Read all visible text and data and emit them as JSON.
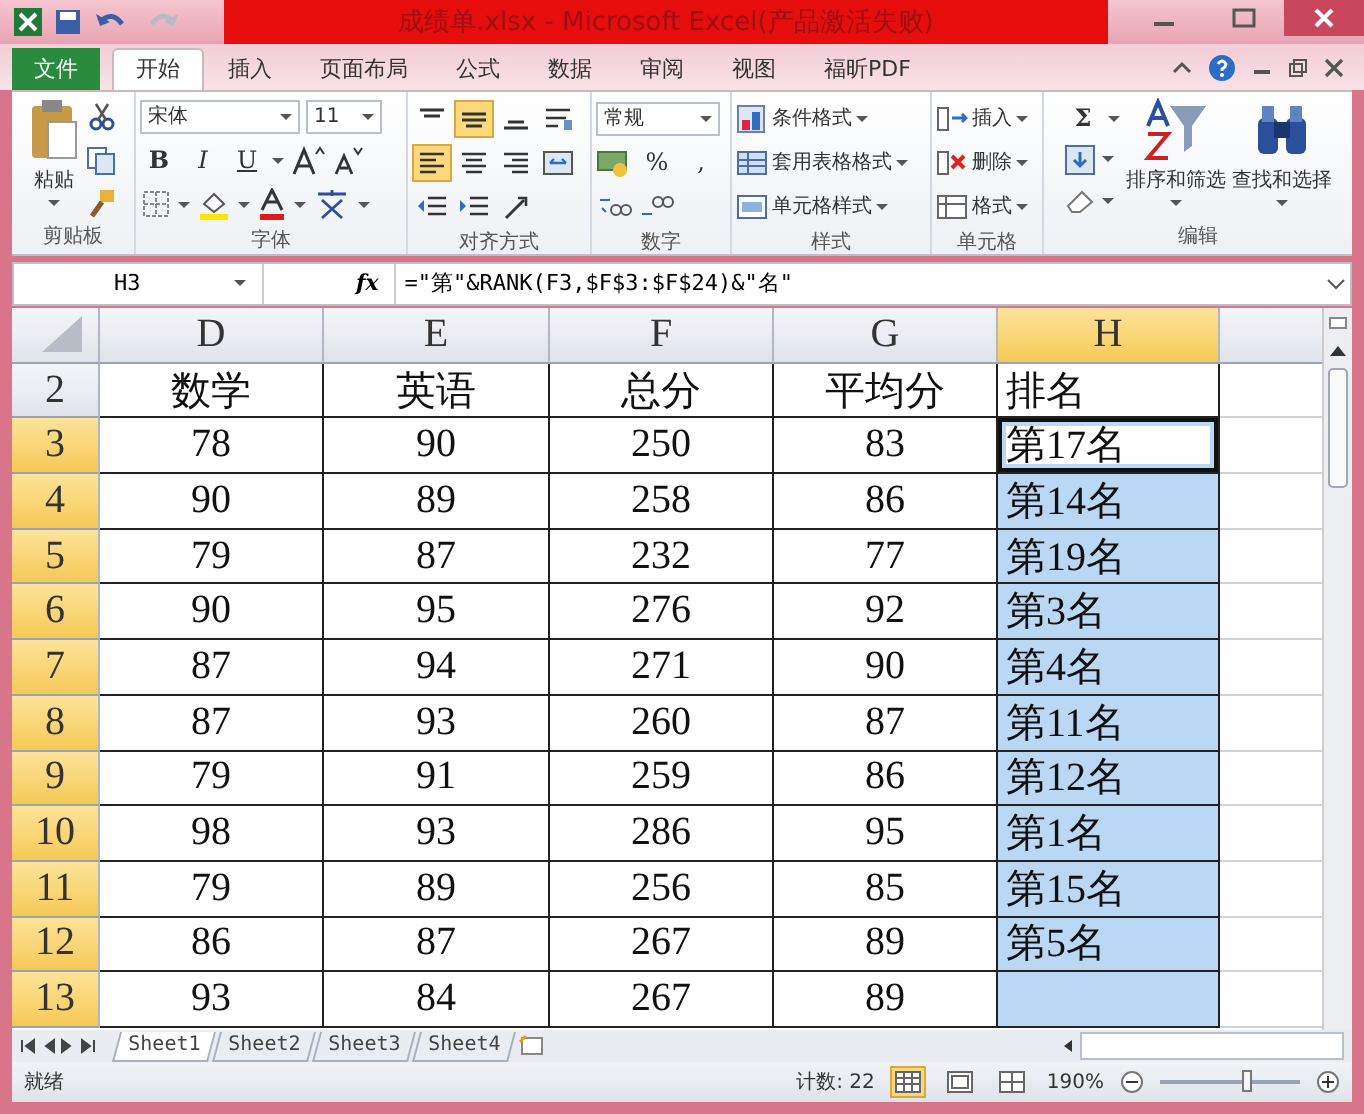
{
  "window": {
    "title": "成绩单.xlsx - Microsoft Excel(产品激活失败)"
  },
  "tabs": [
    {
      "label": "文件",
      "kind": "file",
      "selected": false
    },
    {
      "label": "开始",
      "kind": "tab",
      "selected": true
    },
    {
      "label": "插入",
      "kind": "tab",
      "selected": false
    },
    {
      "label": "页面布局",
      "kind": "tab",
      "selected": false
    },
    {
      "label": "公式",
      "kind": "tab",
      "selected": false
    },
    {
      "label": "数据",
      "kind": "tab",
      "selected": false
    },
    {
      "label": "审阅",
      "kind": "tab",
      "selected": false
    },
    {
      "label": "视图",
      "kind": "tab",
      "selected": false
    },
    {
      "label": "福昕PDF",
      "kind": "tab",
      "selected": false
    }
  ],
  "ribbon": {
    "clipboard": {
      "paste": "粘贴",
      "label": "剪贴板"
    },
    "font": {
      "name": "宋体",
      "size": "11",
      "bold": "B",
      "italic": "I",
      "underline": "U",
      "label": "字体"
    },
    "alignment": {
      "label": "对齐方式",
      "buttons": [
        {
          "kind": "top",
          "selected": false
        },
        {
          "kind": "middle",
          "selected": true
        },
        {
          "kind": "bottom",
          "selected": false
        },
        {
          "kind": "wrap",
          "selected": false
        },
        {
          "kind": "left",
          "selected": true
        },
        {
          "kind": "center",
          "selected": false
        },
        {
          "kind": "right",
          "selected": false
        },
        {
          "kind": "merge",
          "selected": false
        },
        {
          "kind": "outdent",
          "selected": false
        },
        {
          "kind": "indent",
          "selected": false
        },
        {
          "kind": "orient",
          "selected": false
        }
      ]
    },
    "number": {
      "format": "常规",
      "percent": "%",
      "comma": ",",
      "label": "数字"
    },
    "styles": {
      "items": [
        "条件格式",
        "套用表格格式",
        "单元格样式"
      ],
      "label": "样式"
    },
    "cells": {
      "items": [
        "插入",
        "删除",
        "格式"
      ],
      "label": "单元格"
    },
    "editing": {
      "sum": "Σ",
      "sort": "排序和筛选",
      "find": "查找和选择",
      "label": "编辑"
    }
  },
  "formula_bar": {
    "name_box": "H3",
    "fx": "fx",
    "formula": "=\"第\"&RANK(F3,$F$3:$F$24)&\"名\""
  },
  "columns": [
    {
      "label": "D",
      "selected": false
    },
    {
      "label": "E",
      "selected": false
    },
    {
      "label": "F",
      "selected": false
    },
    {
      "label": "G",
      "selected": false
    },
    {
      "label": "H",
      "selected": true
    }
  ],
  "rows": [
    {
      "header": "2",
      "selected": false,
      "cells": [
        "数学",
        "英语",
        "总分",
        "平均分"
      ],
      "rank": {
        "text": "排名",
        "selected": false,
        "active": false
      }
    },
    {
      "header": "3",
      "selected": true,
      "cells": [
        "78",
        "90",
        "250",
        "83"
      ],
      "rank": {
        "text": "第17名",
        "selected": true,
        "active": true
      }
    },
    {
      "header": "4",
      "selected": true,
      "cells": [
        "90",
        "89",
        "258",
        "86"
      ],
      "rank": {
        "text": "第14名",
        "selected": true,
        "active": false
      }
    },
    {
      "header": "5",
      "selected": true,
      "cells": [
        "79",
        "87",
        "232",
        "77"
      ],
      "rank": {
        "text": "第19名",
        "selected": true,
        "active": false
      }
    },
    {
      "header": "6",
      "selected": true,
      "cells": [
        "90",
        "95",
        "276",
        "92"
      ],
      "rank": {
        "text": "第3名",
        "selected": true,
        "active": false
      }
    },
    {
      "header": "7",
      "selected": true,
      "cells": [
        "87",
        "94",
        "271",
        "90"
      ],
      "rank": {
        "text": "第4名",
        "selected": true,
        "active": false
      }
    },
    {
      "header": "8",
      "selected": true,
      "cells": [
        "87",
        "93",
        "260",
        "87"
      ],
      "rank": {
        "text": "第11名",
        "selected": true,
        "active": false
      }
    },
    {
      "header": "9",
      "selected": true,
      "cells": [
        "79",
        "91",
        "259",
        "86"
      ],
      "rank": {
        "text": "第12名",
        "selected": true,
        "active": false
      }
    },
    {
      "header": "10",
      "selected": true,
      "cells": [
        "98",
        "93",
        "286",
        "95"
      ],
      "rank": {
        "text": "第1名",
        "selected": true,
        "active": false
      }
    },
    {
      "header": "11",
      "selected": true,
      "cells": [
        "79",
        "89",
        "256",
        "85"
      ],
      "rank": {
        "text": "第15名",
        "selected": true,
        "active": false
      }
    },
    {
      "header": "12",
      "selected": true,
      "cells": [
        "86",
        "87",
        "267",
        "89"
      ],
      "rank": {
        "text": "第5名",
        "selected": true,
        "active": false
      }
    },
    {
      "header": "13",
      "selected": true,
      "cells": [
        "93",
        "84",
        "267",
        "89"
      ],
      "rank": {
        "selected": true,
        "active": false
      }
    }
  ],
  "sheets": [
    {
      "label": "Sheet1",
      "selected": true
    },
    {
      "label": "Sheet2",
      "selected": false
    },
    {
      "label": "Sheet3",
      "selected": false
    },
    {
      "label": "Sheet4",
      "selected": false
    }
  ],
  "status_bar": {
    "status": "就绪",
    "count": "计数: 22",
    "views": [
      {
        "kind": "normal",
        "selected": true
      },
      {
        "kind": "layout",
        "selected": false
      },
      {
        "kind": "pagebreak",
        "selected": false
      }
    ],
    "zoom": "190%",
    "zoom_slider": {
      "level": 0.62
    }
  }
}
